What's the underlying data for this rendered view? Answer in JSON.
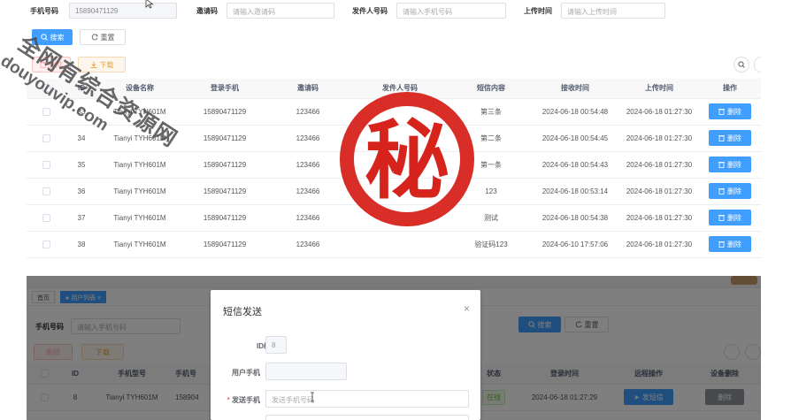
{
  "filters": {
    "phone_label": "手机号码",
    "phone_value": "15890471129",
    "invite_label": "邀请码",
    "invite_placeholder": "请输入邀请码",
    "sender_label": "发件人号码",
    "sender_placeholder": "请输入手机号码",
    "upload_label": "上传时间",
    "upload_placeholder": "请输入上传时间"
  },
  "buttons": {
    "search": "搜索",
    "reset": "重置",
    "delete": "删除",
    "download": "下载"
  },
  "table": {
    "columns": [
      "",
      "ID",
      "设备名称",
      "登录手机",
      "邀请码",
      "发件人号码",
      "短信内容",
      "接收时间",
      "上传时间",
      "操作"
    ],
    "row_action": "删除",
    "rows": [
      {
        "id": "33",
        "device": "Tianyi TYH601M",
        "phone": "15890471129",
        "invite": "123466",
        "sender": "",
        "content": "第三条",
        "received": "2024-06-18 00:54:48",
        "uploaded": "2024-06-18 01:27:30"
      },
      {
        "id": "34",
        "device": "Tianyi TYH601M",
        "phone": "15890471129",
        "invite": "123466",
        "sender": "",
        "content": "第二条",
        "received": "2024-06-18 00:54:45",
        "uploaded": "2024-06-18 01:27:30"
      },
      {
        "id": "35",
        "device": "Tianyi TYH601M",
        "phone": "15890471129",
        "invite": "123466",
        "sender": "",
        "content": "第一条",
        "received": "2024-06-18 00:54:43",
        "uploaded": "2024-06-18 01:27:30"
      },
      {
        "id": "36",
        "device": "Tianyi TYH601M",
        "phone": "15890471129",
        "invite": "123466",
        "sender": "",
        "content": "123",
        "received": "2024-06-18 00:53:14",
        "uploaded": "2024-06-18 01:27:30"
      },
      {
        "id": "37",
        "device": "Tianyi TYH601M",
        "phone": "15890471129",
        "invite": "123466",
        "sender": "",
        "content": "测试",
        "received": "2024-06-18 00:54:38",
        "uploaded": "2024-06-18 01:27:30"
      },
      {
        "id": "38",
        "device": "Tianyi TYH601M",
        "phone": "15890471129",
        "invite": "123466",
        "sender": "",
        "content": "验证码123",
        "received": "2024-06-10 17:57:06",
        "uploaded": "2024-06-18 01:27:30"
      }
    ]
  },
  "watermark": {
    "line1": "全网有综合资源网",
    "line2": "douyouvip.com"
  },
  "seal": {
    "char": "秘"
  },
  "bottom": {
    "tab_home": "首页",
    "tab_user_list": "用户列表",
    "phone_label": "手机号码",
    "phone_placeholder": "请输入手机号码",
    "search": "搜索",
    "reset": "重置",
    "delete": "删除",
    "download": "下载",
    "columns": [
      "",
      "ID",
      "手机型号",
      "手机号",
      "状态",
      "登录时间",
      "远程操作",
      "设备删除"
    ],
    "row": {
      "id": "8",
      "model": "Tianyi TYH601M",
      "phone": "158904",
      "status": "在线",
      "login_time": "2024-06-18 01:27:29",
      "remote_action": "发短信",
      "device_delete": "删除"
    }
  },
  "dialog": {
    "title": "短信发送",
    "id_label": "ID编号",
    "id_value": "8",
    "user_phone_label": "用户手机",
    "user_phone_value": "",
    "send_phone_label": "发送手机",
    "send_phone_placeholder": "发送手机号码"
  },
  "colors": {
    "primary": "#409eff",
    "seal_red": "#d6231b",
    "success": "#67c23a"
  }
}
